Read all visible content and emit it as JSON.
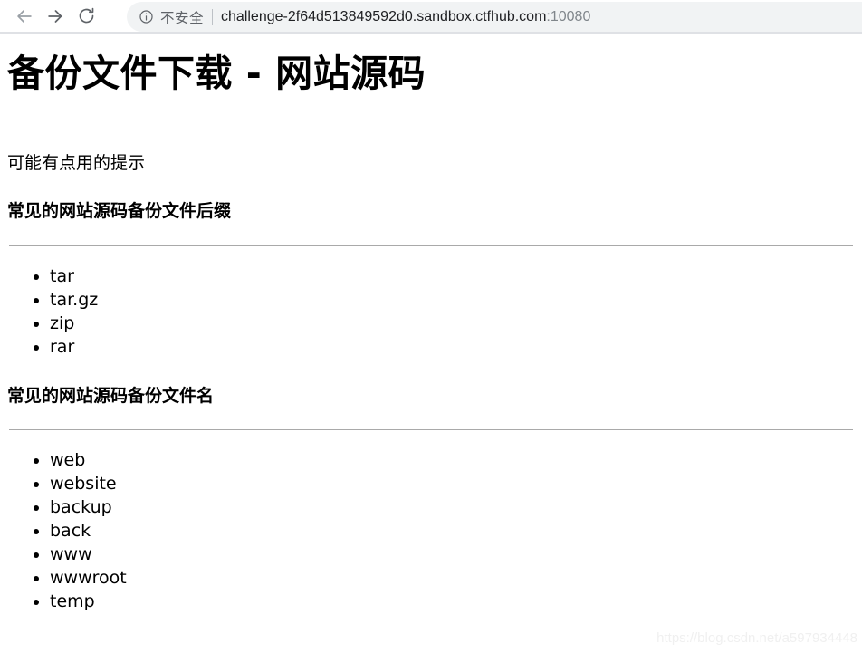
{
  "browser": {
    "back_label": "back-arrow",
    "forward_label": "forward-arrow",
    "reload_label": "reload",
    "security_icon": "info-circle-icon",
    "security_text": "不安全",
    "url": "challenge-2f64d513849592d0.sandbox.ctfhub.com",
    "url_port": ":10080",
    "url_full": "challenge-2f64d513849592d0.sandbox.ctfhub.com:10080"
  },
  "page": {
    "title": "备份文件下载 - 网站源码",
    "hint": "可能有点用的提示",
    "sections": [
      {
        "heading": "常见的网站源码备份文件后缀",
        "items": [
          "tar",
          "tar.gz",
          "zip",
          "rar"
        ]
      },
      {
        "heading": "常见的网站源码备份文件名",
        "items": [
          "web",
          "website",
          "backup",
          "back",
          "www",
          "wwwroot",
          "temp"
        ]
      }
    ],
    "watermark": "https://blog.csdn.net/a597934448"
  },
  "colors": {
    "omnibox_bg": "#f1f3f4",
    "security_text": "#5f6368",
    "url_text": "#202124",
    "port_text": "#80868b",
    "rule": "#a9a9a9",
    "watermark": "#f0f0f0"
  }
}
